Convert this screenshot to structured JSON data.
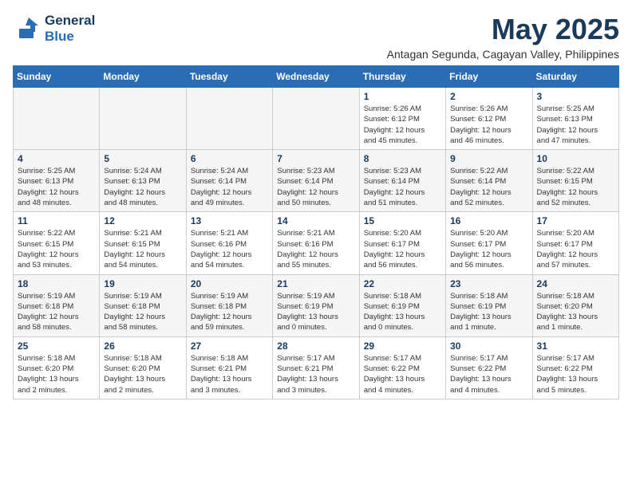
{
  "header": {
    "logo_line1": "General",
    "logo_line2": "Blue",
    "month": "May 2025",
    "location": "Antagan Segunda, Cagayan Valley, Philippines"
  },
  "weekdays": [
    "Sunday",
    "Monday",
    "Tuesday",
    "Wednesday",
    "Thursday",
    "Friday",
    "Saturday"
  ],
  "weeks": [
    [
      {
        "day": "",
        "info": ""
      },
      {
        "day": "",
        "info": ""
      },
      {
        "day": "",
        "info": ""
      },
      {
        "day": "",
        "info": ""
      },
      {
        "day": "1",
        "info": "Sunrise: 5:26 AM\nSunset: 6:12 PM\nDaylight: 12 hours\nand 45 minutes."
      },
      {
        "day": "2",
        "info": "Sunrise: 5:26 AM\nSunset: 6:12 PM\nDaylight: 12 hours\nand 46 minutes."
      },
      {
        "day": "3",
        "info": "Sunrise: 5:25 AM\nSunset: 6:13 PM\nDaylight: 12 hours\nand 47 minutes."
      }
    ],
    [
      {
        "day": "4",
        "info": "Sunrise: 5:25 AM\nSunset: 6:13 PM\nDaylight: 12 hours\nand 48 minutes."
      },
      {
        "day": "5",
        "info": "Sunrise: 5:24 AM\nSunset: 6:13 PM\nDaylight: 12 hours\nand 48 minutes."
      },
      {
        "day": "6",
        "info": "Sunrise: 5:24 AM\nSunset: 6:14 PM\nDaylight: 12 hours\nand 49 minutes."
      },
      {
        "day": "7",
        "info": "Sunrise: 5:23 AM\nSunset: 6:14 PM\nDaylight: 12 hours\nand 50 minutes."
      },
      {
        "day": "8",
        "info": "Sunrise: 5:23 AM\nSunset: 6:14 PM\nDaylight: 12 hours\nand 51 minutes."
      },
      {
        "day": "9",
        "info": "Sunrise: 5:22 AM\nSunset: 6:14 PM\nDaylight: 12 hours\nand 52 minutes."
      },
      {
        "day": "10",
        "info": "Sunrise: 5:22 AM\nSunset: 6:15 PM\nDaylight: 12 hours\nand 52 minutes."
      }
    ],
    [
      {
        "day": "11",
        "info": "Sunrise: 5:22 AM\nSunset: 6:15 PM\nDaylight: 12 hours\nand 53 minutes."
      },
      {
        "day": "12",
        "info": "Sunrise: 5:21 AM\nSunset: 6:15 PM\nDaylight: 12 hours\nand 54 minutes."
      },
      {
        "day": "13",
        "info": "Sunrise: 5:21 AM\nSunset: 6:16 PM\nDaylight: 12 hours\nand 54 minutes."
      },
      {
        "day": "14",
        "info": "Sunrise: 5:21 AM\nSunset: 6:16 PM\nDaylight: 12 hours\nand 55 minutes."
      },
      {
        "day": "15",
        "info": "Sunrise: 5:20 AM\nSunset: 6:17 PM\nDaylight: 12 hours\nand 56 minutes."
      },
      {
        "day": "16",
        "info": "Sunrise: 5:20 AM\nSunset: 6:17 PM\nDaylight: 12 hours\nand 56 minutes."
      },
      {
        "day": "17",
        "info": "Sunrise: 5:20 AM\nSunset: 6:17 PM\nDaylight: 12 hours\nand 57 minutes."
      }
    ],
    [
      {
        "day": "18",
        "info": "Sunrise: 5:19 AM\nSunset: 6:18 PM\nDaylight: 12 hours\nand 58 minutes."
      },
      {
        "day": "19",
        "info": "Sunrise: 5:19 AM\nSunset: 6:18 PM\nDaylight: 12 hours\nand 58 minutes."
      },
      {
        "day": "20",
        "info": "Sunrise: 5:19 AM\nSunset: 6:18 PM\nDaylight: 12 hours\nand 59 minutes."
      },
      {
        "day": "21",
        "info": "Sunrise: 5:19 AM\nSunset: 6:19 PM\nDaylight: 13 hours\nand 0 minutes."
      },
      {
        "day": "22",
        "info": "Sunrise: 5:18 AM\nSunset: 6:19 PM\nDaylight: 13 hours\nand 0 minutes."
      },
      {
        "day": "23",
        "info": "Sunrise: 5:18 AM\nSunset: 6:19 PM\nDaylight: 13 hours\nand 1 minute."
      },
      {
        "day": "24",
        "info": "Sunrise: 5:18 AM\nSunset: 6:20 PM\nDaylight: 13 hours\nand 1 minute."
      }
    ],
    [
      {
        "day": "25",
        "info": "Sunrise: 5:18 AM\nSunset: 6:20 PM\nDaylight: 13 hours\nand 2 minutes."
      },
      {
        "day": "26",
        "info": "Sunrise: 5:18 AM\nSunset: 6:20 PM\nDaylight: 13 hours\nand 2 minutes."
      },
      {
        "day": "27",
        "info": "Sunrise: 5:18 AM\nSunset: 6:21 PM\nDaylight: 13 hours\nand 3 minutes."
      },
      {
        "day": "28",
        "info": "Sunrise: 5:17 AM\nSunset: 6:21 PM\nDaylight: 13 hours\nand 3 minutes."
      },
      {
        "day": "29",
        "info": "Sunrise: 5:17 AM\nSunset: 6:22 PM\nDaylight: 13 hours\nand 4 minutes."
      },
      {
        "day": "30",
        "info": "Sunrise: 5:17 AM\nSunset: 6:22 PM\nDaylight: 13 hours\nand 4 minutes."
      },
      {
        "day": "31",
        "info": "Sunrise: 5:17 AM\nSunset: 6:22 PM\nDaylight: 13 hours\nand 5 minutes."
      }
    ]
  ]
}
